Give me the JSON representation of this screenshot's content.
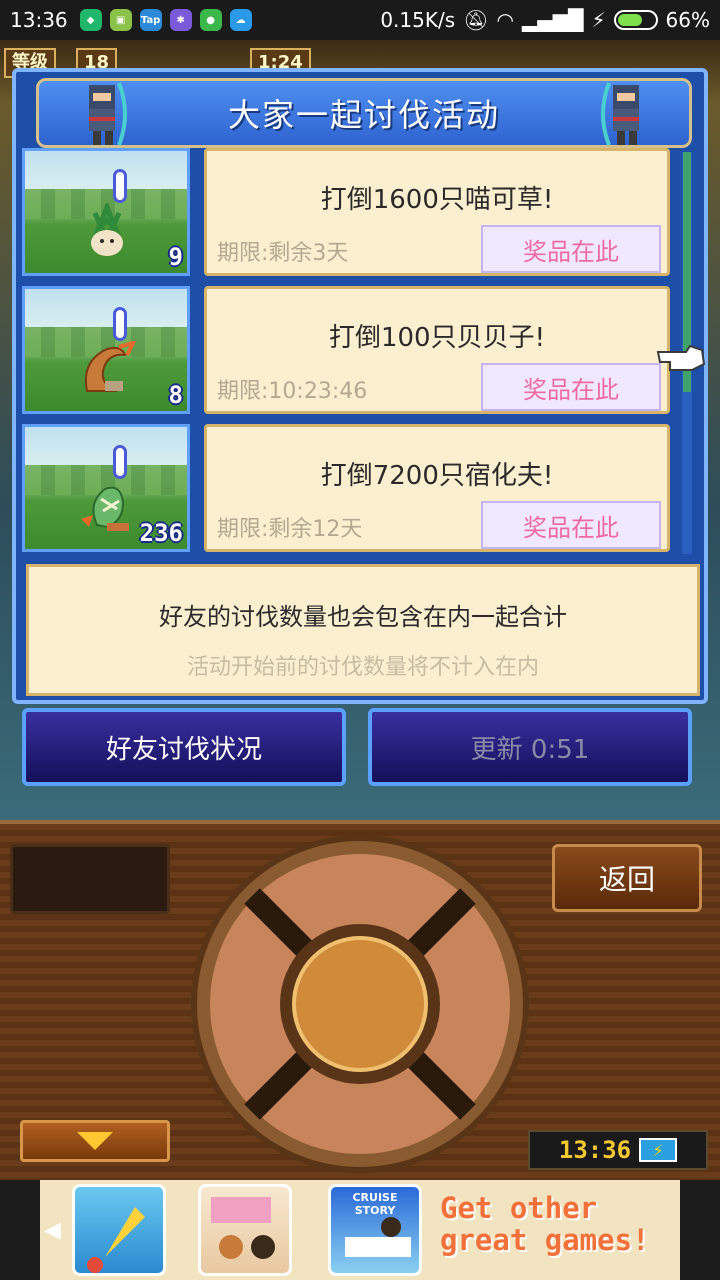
{
  "status_bar": {
    "time": "13:36",
    "app_icons": [
      "shield-icon",
      "android-icon",
      "tap-icon",
      "pinwheel-icon",
      "chat-icon",
      "cloud-icon"
    ],
    "net_speed": "0.15K/s",
    "battery": "66%",
    "battery_level": 0.66
  },
  "dialog": {
    "title": "大家一起讨伐活动",
    "events": [
      {
        "title": "打倒1600只喵可草!",
        "deadline": "期限:剩余3天",
        "prize_label": "奖品在此",
        "count": "9",
        "monster": "grass-monster"
      },
      {
        "title": "打倒100只贝贝子!",
        "deadline": "期限:10:23:46",
        "prize_label": "奖品在此",
        "count": "8",
        "monster": "shell-monster"
      },
      {
        "title": "打倒7200只宿化夫!",
        "deadline": "期限:剩余12天",
        "prize_label": "奖品在此",
        "count": "236",
        "monster": "hermit-crab-monster"
      }
    ],
    "info_line1": "好友的讨伐数量也会包含在内一起合计",
    "info_line2": "活动开始前的讨伐数量将不计入在内"
  },
  "buttons": {
    "friends_status": "好友讨伐状况",
    "refresh": "更新 0:51",
    "back": "返回"
  },
  "hud": {
    "level_label": "等级",
    "level": "18",
    "timer": "1:24"
  },
  "panel": {
    "clock": "13:36"
  },
  "ad": {
    "text": "Get other great games!",
    "tile_labels": [
      "",
      "",
      "CRUISE STORY"
    ]
  },
  "colors": {
    "dialog_blue": "#1d4fa8",
    "card_bg": "#fbefd0",
    "prize_text": "#f06aa0",
    "ad_text": "#f2703a"
  }
}
